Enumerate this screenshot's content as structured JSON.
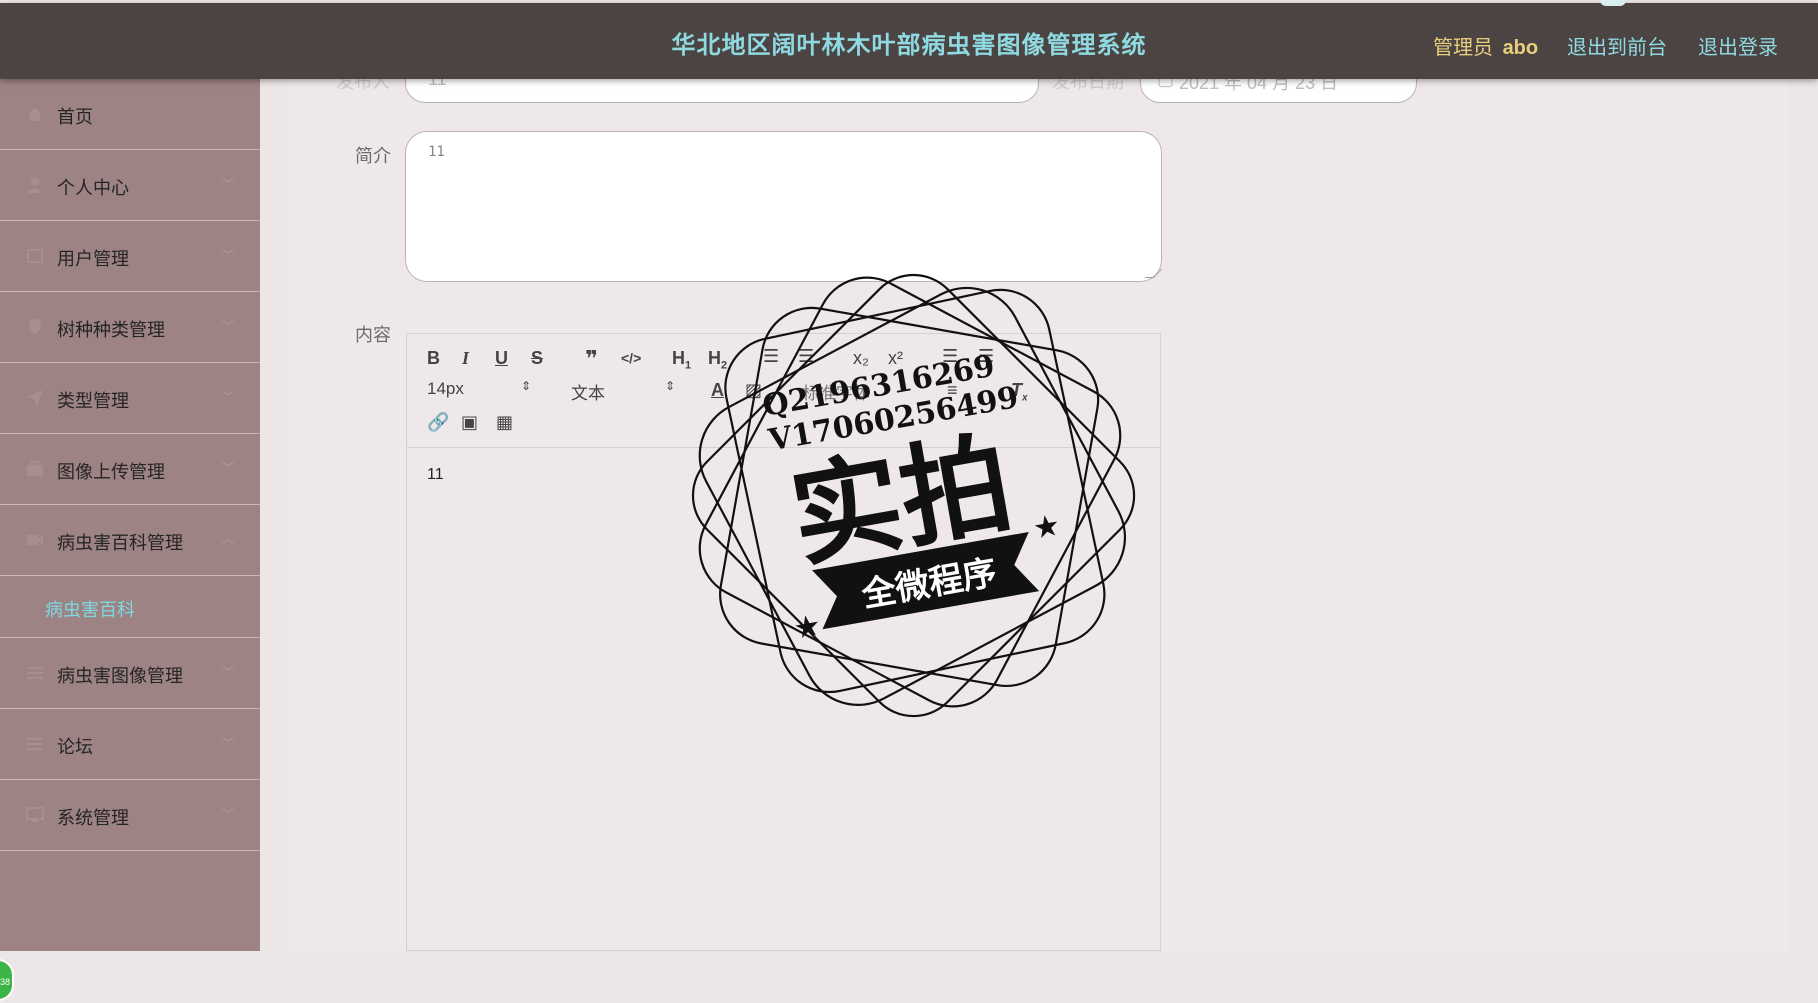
{
  "header": {
    "title": "华北地区阔叶林木叶部病虫害图像管理系统",
    "user_role": "管理员",
    "username": "abo",
    "front_link": "退出到前台",
    "logout_link": "退出登录"
  },
  "sidebar": {
    "items": [
      {
        "label": "首页",
        "icon": "home-icon"
      },
      {
        "label": "个人中心",
        "icon": "user-icon"
      },
      {
        "label": "用户管理",
        "icon": "users-icon"
      },
      {
        "label": "树种种类管理",
        "icon": "pin-icon"
      },
      {
        "label": "类型管理",
        "icon": "send-icon"
      },
      {
        "label": "图像上传管理",
        "icon": "briefcase-icon"
      },
      {
        "label": "病虫害百科管理",
        "icon": "video-icon"
      },
      {
        "label": "病虫害图像管理",
        "icon": "list-icon"
      },
      {
        "label": "论坛",
        "icon": "list-icon"
      },
      {
        "label": "系统管理",
        "icon": "monitor-icon"
      }
    ],
    "sub_item": "病虫害百科",
    "float_badge": "38"
  },
  "form": {
    "publisher_label": "发布人",
    "publisher_value": "11",
    "date_label": "发布日期",
    "date_value": "2021 年 04 月 23 日",
    "summary_label": "简介",
    "summary_value": "11",
    "content_label": "内容"
  },
  "editor": {
    "font_size": "14px",
    "paragraph": "文本",
    "font_family": "标准字体",
    "content": "11",
    "buttons": [
      "bold-icon",
      "italic-icon",
      "underline-icon",
      "strike-icon",
      "quote-icon",
      "code-icon",
      "h1-icon",
      "h2-icon",
      "ordered-list-icon",
      "bullet-list-icon",
      "subscript-icon",
      "superscript-icon",
      "outdent-icon",
      "indent-icon",
      "font-color-icon",
      "background-color-icon",
      "align-icon",
      "clear-format-icon",
      "link-icon",
      "image-icon",
      "video-icon"
    ]
  },
  "watermark": {
    "qq": "Q2196316269",
    "wechat": "V17060256499",
    "main": "实拍",
    "ribbon": "全微程序"
  },
  "colors": {
    "topbar": "#4b4443",
    "title": "#8fd9e0",
    "user": "#e8cf7c",
    "sidebar": "#9d8384",
    "active_sub": "#7fd7e0",
    "content_bg": "#efe8e8"
  }
}
